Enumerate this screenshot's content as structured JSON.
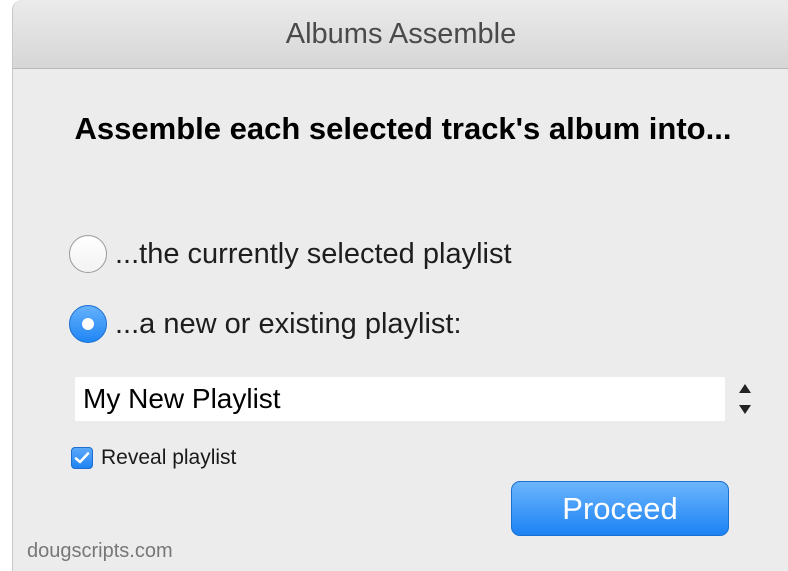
{
  "window": {
    "title": "Albums Assemble"
  },
  "prompt": "Assemble each selected track's album into...",
  "options": [
    {
      "label": "...the currently selected playlist",
      "selected": false
    },
    {
      "label": "...a new or existing playlist:",
      "selected": true
    }
  ],
  "playlist_field": {
    "value": "My New Playlist"
  },
  "reveal": {
    "label": "Reveal playlist",
    "checked": true
  },
  "proceed_label": "Proceed",
  "credit": "dougscripts.com",
  "colors": {
    "accent": "#1f86f4",
    "window_bg": "#ececec"
  }
}
